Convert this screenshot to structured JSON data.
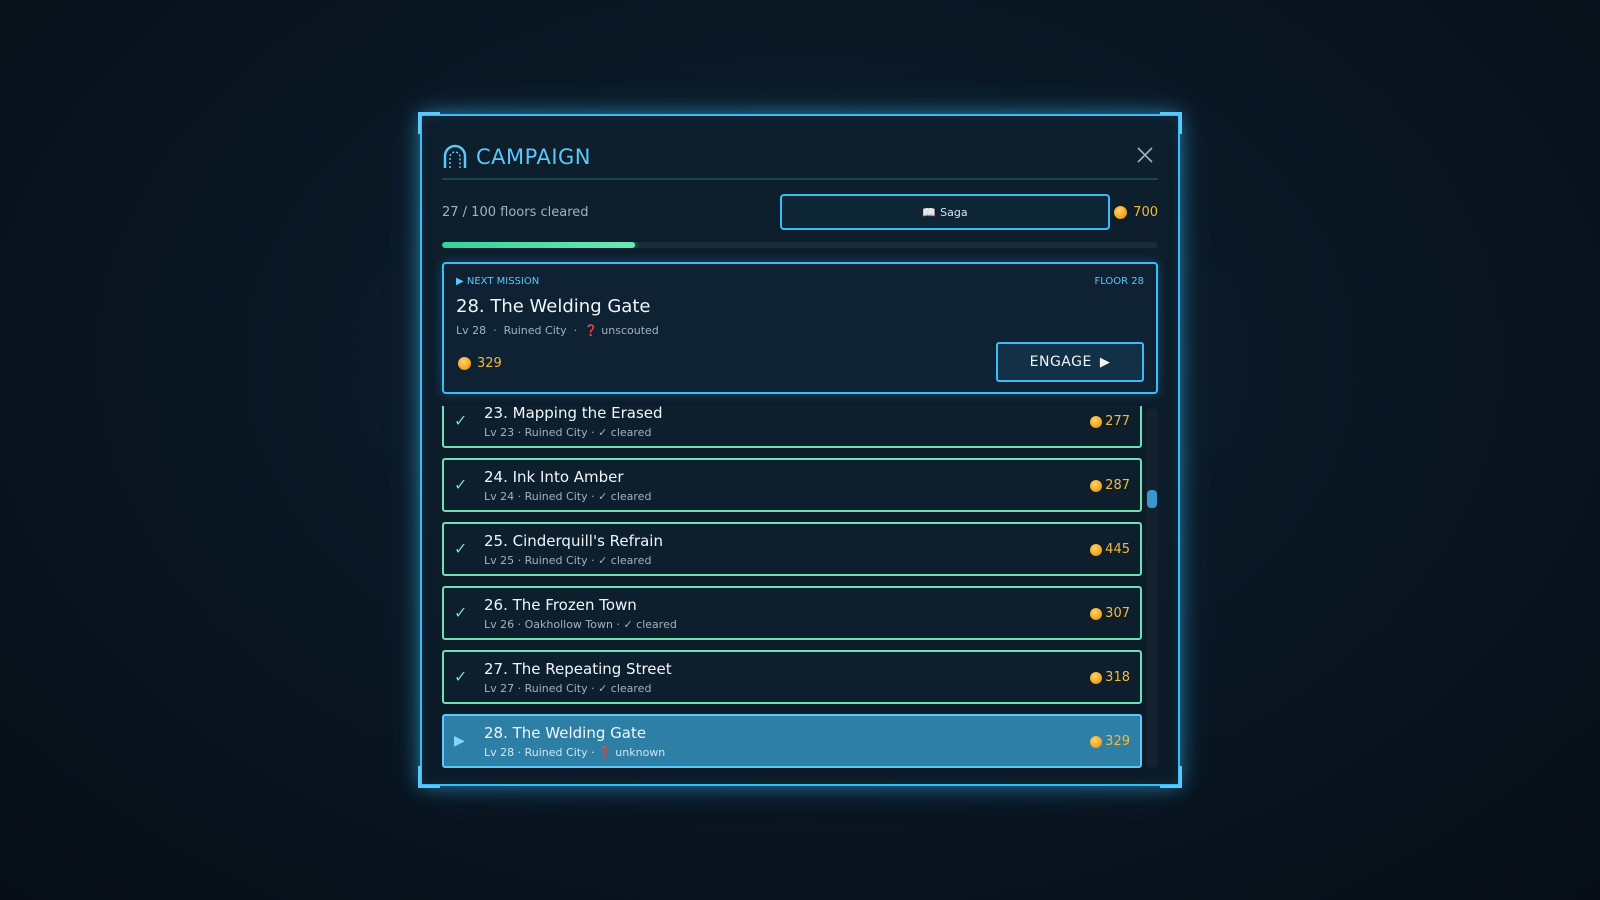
{
  "header": {
    "title": "CAMPAIGN",
    "title_icon": "arch-icon",
    "close_icon": "close-icon"
  },
  "stats": {
    "floors_cleared": "27 / 100 floors cleared",
    "saga_label": "Saga",
    "saga_icon": "book-icon",
    "gold": "700"
  },
  "progress": {
    "cleared": 27,
    "total": 100
  },
  "next_mission": {
    "tag": "▶ NEXT MISSION",
    "floor_tag": "FLOOR 28",
    "name": "28. The Welding Gate",
    "meta_level": "Lv 28",
    "meta_region": "Ruined City",
    "meta_status": "unscouted",
    "reward": "329",
    "engage_label": "ENGAGE"
  },
  "missions": [
    {
      "name": "23. Mapping the Erased",
      "meta": "Lv 23 · Ruined City · ✓ cleared",
      "gold": "277",
      "state": "cleared"
    },
    {
      "name": "24. Ink Into Amber",
      "meta": "Lv 24 · Ruined City · ✓ cleared",
      "gold": "287",
      "state": "cleared"
    },
    {
      "name": "25. Cinderquill's Refrain",
      "meta": "Lv 25 · Ruined City · ✓ cleared",
      "gold": "445",
      "state": "cleared"
    },
    {
      "name": "26. The Frozen Town",
      "meta": "Lv 26 · Oakhollow Town · ✓ cleared",
      "gold": "307",
      "state": "cleared"
    },
    {
      "name": "27. The Repeating Street",
      "meta": "Lv 27 · Ruined City · ✓ cleared",
      "gold": "318",
      "state": "cleared"
    },
    {
      "name": "28. The Welding Gate",
      "meta_prefix": "Lv 28 · Ruined City · ",
      "meta_status": "unknown",
      "gold": "329",
      "state": "active"
    }
  ],
  "colors": {
    "accent": "#38bdf8",
    "cleared": "#6fe0b0",
    "gold": "#f5b940",
    "progress": "#34d399"
  }
}
